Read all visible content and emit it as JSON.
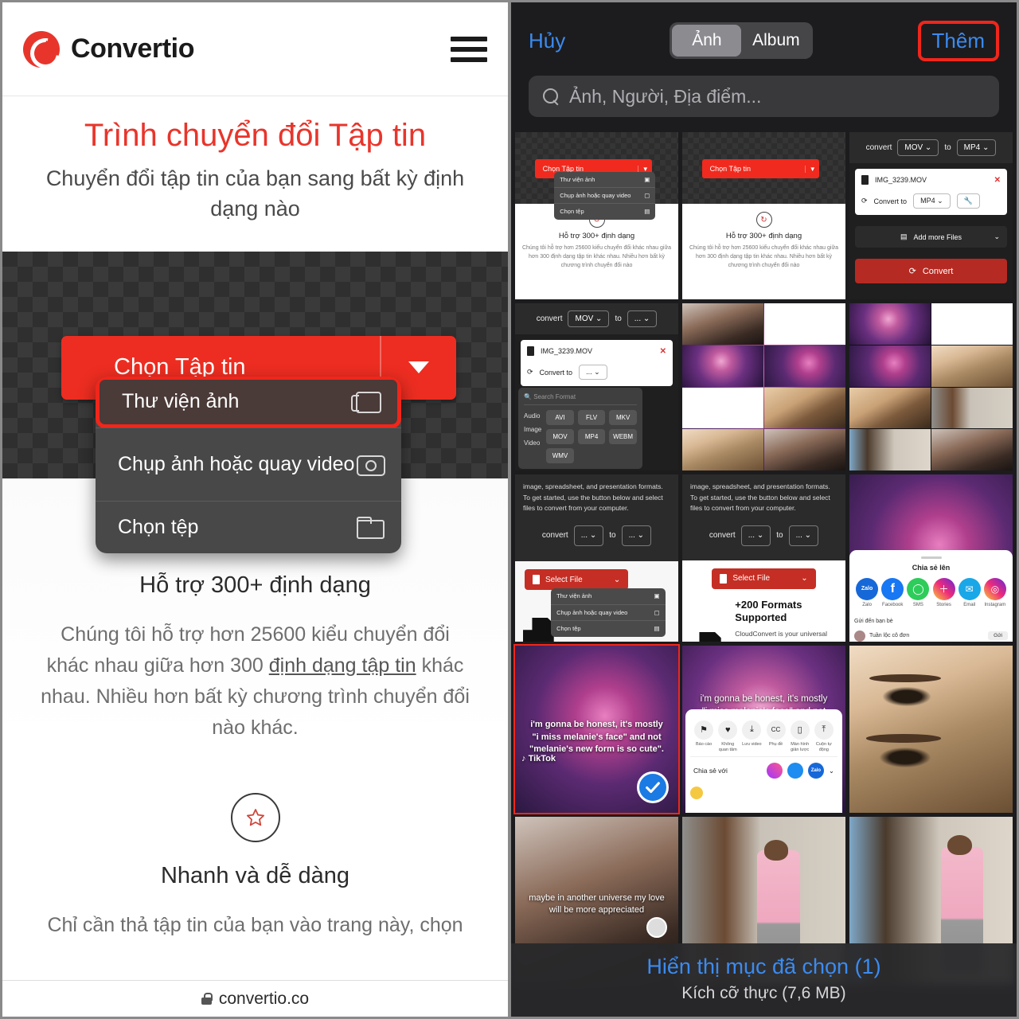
{
  "left": {
    "brand_name": "Convertio",
    "menu_icon": "hamburger-icon",
    "hero_title": "Trình chuyển đổi Tập tin",
    "hero_subtitle": "Chuyển đổi tập tin của bạn sang bất kỳ định dạng nào",
    "select_file_button": "Chọn Tập tin",
    "dropdown": {
      "items": [
        {
          "label": "Thư viện ảnh",
          "icon": "photos-icon",
          "highlighted": true
        },
        {
          "label": "Chụp ảnh hoặc quay video",
          "icon": "camera-icon",
          "highlighted": false
        },
        {
          "label": "Chọn tệp",
          "icon": "folder-icon",
          "highlighted": false
        }
      ]
    },
    "features": [
      {
        "icon": "refresh-circle-icon",
        "title": "Hỗ trợ 300+ định dạng",
        "body_1": "Chúng tôi hỗ trợ hơn 25600 kiểu chuyển đổi khác nhau giữa hơn 300 ",
        "body_link": "định dạng tập tin",
        "body_2": " khác nhau. Nhiều hơn bất kỳ chương trình chuyển đổi nào khác."
      },
      {
        "icon": "star-circle-icon",
        "title": "Nhanh và dễ dàng",
        "body_1": "Chỉ cần thả tập tin của bạn vào trang này, chọn"
      }
    ],
    "url_bar": {
      "lock": "lock-icon",
      "url": "convertio.co"
    }
  },
  "right": {
    "cancel_label": "Hủy",
    "add_label": "Thêm",
    "segments": [
      {
        "label": "Ảnh",
        "active": true
      },
      {
        "label": "Album",
        "active": false
      }
    ],
    "search_placeholder": "Ảnh, Người, Địa điểm...",
    "footer": {
      "selected_label": "Hiển thị mục đã chọn (1)",
      "size_label": "Kích cỡ thực (7,6 MB)"
    },
    "thumbs": {
      "convertio_button": "Chọn Tập tin",
      "dd_photos": "Thư viện ảnh",
      "dd_camera": "Chụp ảnh hoặc quay video",
      "dd_file": "Chọn tệp",
      "feature_title": "Hỗ trợ 300+ định dạng",
      "feature_body": "Chúng tôi hỗ trợ hơn 25600 kiểu chuyển đổi khác nhau giữa hơn 300 định dạng tập tin khác nhau. Nhiều hơn bất kỳ chương trình chuyển đổi nào",
      "convert_word": "convert",
      "to_word": "to",
      "fmt_mov": "MOV",
      "fmt_mp4": "MP4",
      "fmt_blank": "...",
      "file_name": "IMG_3239.MOV",
      "convert_to_label": "Convert to",
      "add_more_files": "Add more Files",
      "convert_button": "Convert",
      "search_format": "Search Format",
      "cat_audio": "Audio",
      "cat_image": "Image",
      "cat_video": "Video",
      "fmt_chips": [
        "AVI",
        "FLV",
        "MKV",
        "MOV",
        "MP4",
        "WEBM",
        "WMV"
      ],
      "cc_paragraph": "image, spreadsheet, and presentation formats. To get started, use the button below and select files to convert from your computer.",
      "select_file_en": "Select File",
      "cc_heading": "+200 Formats Supported",
      "cc_body": "CloudConvert is your universal app for file conversions. We",
      "share_header": "Chia sẻ lên",
      "share_targets": [
        "Zalo",
        "Facebook",
        "SMS",
        "Stories",
        "Email",
        "Instagram"
      ],
      "send_friends": "Gửi đến bạn bè",
      "friend_name": "Tuần lộc cô đơn",
      "send_button": "Gửi",
      "tiktok_caption": "i'm gonna be honest, it's mostly \"i miss melanie's face\" and not \"melanie's new form is so cute\".",
      "tiktok_caption_2": "maybe in another universe my love will be more appreciated",
      "tiktok_user": "TikTok",
      "action_labels": [
        "Báo cáo",
        "Không quan tâm",
        "Lưu video",
        "Phụ đề",
        "Màn hình giản lược",
        "Cuộn tự động"
      ],
      "share_with": "Chia sẻ với"
    }
  },
  "colors": {
    "brand_red": "#e8352b",
    "ios_blue": "#3b8bf0",
    "highlight_red": "#f0261b",
    "dark_bg": "#1c1c1e"
  }
}
